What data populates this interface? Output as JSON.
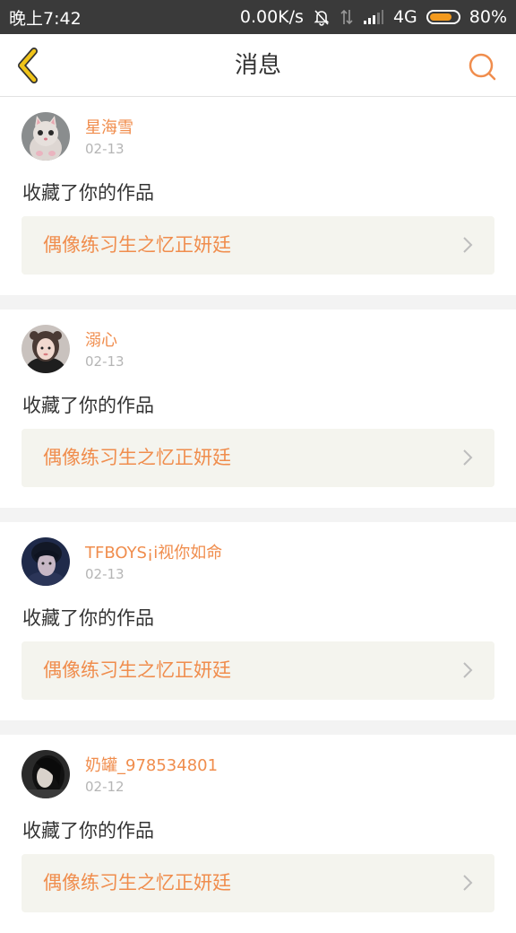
{
  "status_bar": {
    "time": "晚上7:42",
    "speed": "0.00K/s",
    "network": "4G",
    "battery": "80%",
    "battery_level": 0.8
  },
  "header": {
    "title": "消息",
    "back_icon": "chevron-left-icon",
    "search_icon": "search-icon"
  },
  "colors": {
    "accent": "#f08d4d",
    "back_icon": "#f0c419",
    "date": "#b5b5b5",
    "card_bg": "#f4f4ee"
  },
  "messages": [
    {
      "username": "星海雪",
      "date": "02-13",
      "action": "收藏了你的作品",
      "work_title": "偶像练习生之忆正妍廷"
    },
    {
      "username": "溺心",
      "date": "02-13",
      "action": "收藏了你的作品",
      "work_title": "偶像练习生之忆正妍廷"
    },
    {
      "username": "TFBOYS¡i视你如命",
      "date": "02-13",
      "action": "收藏了你的作品",
      "work_title": "偶像练习生之忆正妍廷"
    },
    {
      "username": "奶罐_978534801",
      "date": "02-12",
      "action": "收藏了你的作品",
      "work_title": "偶像练习生之忆正妍廷"
    }
  ]
}
